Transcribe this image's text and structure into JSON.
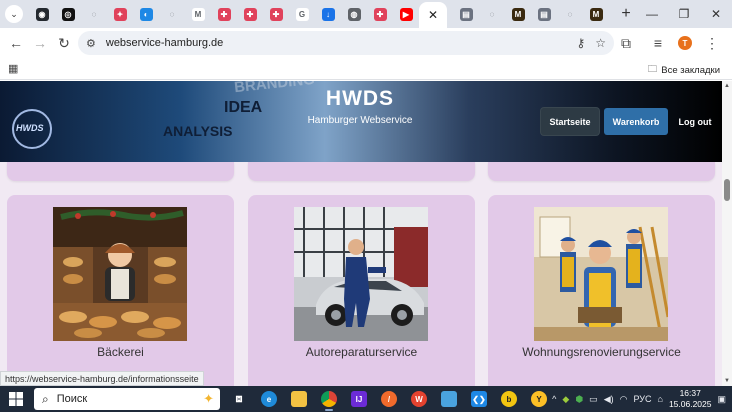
{
  "browser": {
    "tabs": [
      {
        "name": "tab-github",
        "color": "#24292f",
        "glyph": "◉"
      },
      {
        "name": "tab-chatgpt",
        "color": "#111111",
        "glyph": "◎"
      },
      {
        "name": "tab-blank-1",
        "color": "#dfe3eb",
        "glyph": "◌"
      },
      {
        "name": "tab-figma-like",
        "color": "#e0425b",
        "glyph": "✦"
      },
      {
        "name": "tab-messenger",
        "color": "#1e88e5",
        "glyph": "◐"
      },
      {
        "name": "tab-blank-2",
        "color": "#dfe3eb",
        "glyph": "◌"
      },
      {
        "name": "tab-gmail",
        "color": "#ffffff",
        "glyph": "M"
      },
      {
        "name": "tab-red-1",
        "color": "#e0425b",
        "glyph": "✚"
      },
      {
        "name": "tab-red-2",
        "color": "#e0425b",
        "glyph": "✚"
      },
      {
        "name": "tab-red-3",
        "color": "#e0425b",
        "glyph": "✚"
      },
      {
        "name": "tab-google",
        "color": "#ffffff",
        "glyph": "G"
      },
      {
        "name": "tab-downloads",
        "color": "#1a73e8",
        "glyph": "↓"
      },
      {
        "name": "tab-globe",
        "color": "#5f6368",
        "glyph": "◍"
      },
      {
        "name": "tab-red-4",
        "color": "#e0425b",
        "glyph": "✚"
      },
      {
        "name": "tab-youtube",
        "color": "#ff0000",
        "glyph": "▶"
      }
    ],
    "tabs_after": [
      {
        "name": "tab-printer-1",
        "color": "#6b7280",
        "glyph": "▤"
      },
      {
        "name": "tab-blank-3",
        "color": "#dfe3eb",
        "glyph": "◌"
      },
      {
        "name": "tab-m-1",
        "color": "#3a2a10",
        "glyph": "M"
      },
      {
        "name": "tab-printer-2",
        "color": "#6b7280",
        "glyph": "▤"
      },
      {
        "name": "tab-blank-4",
        "color": "#dfe3eb",
        "glyph": "◌"
      },
      {
        "name": "tab-m-2",
        "color": "#3a2a10",
        "glyph": "M"
      }
    ],
    "url": "webservice-hamburg.de",
    "avatar_letter": "T",
    "all_bookmarks": "Все закладки"
  },
  "site": {
    "brand": "HWDS",
    "brand_sub": "Hamburger Webservice",
    "logo_text": "HWDS",
    "hero_words": [
      "BRANDING",
      "IDEA",
      "ANALYSIS"
    ],
    "nav": {
      "home": "Startseite",
      "cart": "Warenkorb",
      "logout": "Log out"
    },
    "cards": [
      {
        "caption": "Bäckerei"
      },
      {
        "caption": "Autoreparaturservice"
      },
      {
        "caption": "Wohnungsrenovierungservice"
      }
    ]
  },
  "status_url": "https://webservice-hamburg.de/informationsseite",
  "taskbar": {
    "search_placeholder": "Поиск",
    "language": "РУС",
    "time": "16:37",
    "date": "15.06.2025"
  }
}
